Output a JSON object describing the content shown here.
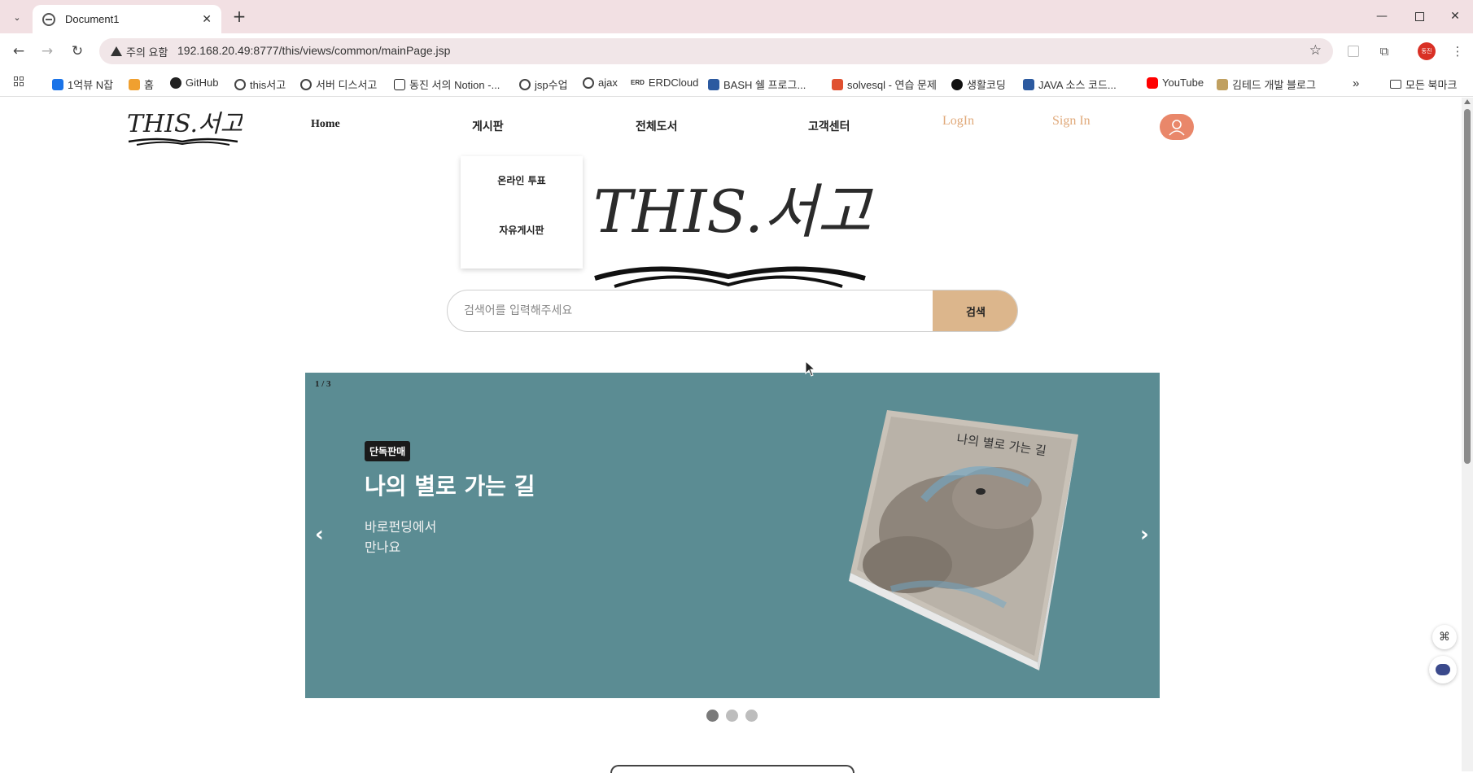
{
  "browser": {
    "tab_title": "Document1",
    "security_label": "주의 요함",
    "url": "192.168.20.49:8777/this/views/common/mainPage.jsp",
    "profile_label": "동진",
    "bookmarks": [
      {
        "label": "1억뷰 N잡",
        "color": "#1a73e8"
      },
      {
        "label": "홈",
        "color": "#f0a030"
      },
      {
        "label": "GitHub",
        "color": "#222222"
      },
      {
        "label": "this서고",
        "color": "#444444"
      },
      {
        "label": "서버 디스서고",
        "color": "#444444"
      },
      {
        "label": "동진 서의 Notion -...",
        "color": "#222222"
      },
      {
        "label": "jsp수업",
        "color": "#444444"
      },
      {
        "label": "ajax",
        "color": "#444444"
      },
      {
        "label": "ERDCloud",
        "color": "#333333"
      },
      {
        "label": "BASH 쉘 프로그...",
        "color": "#2c5aa0"
      },
      {
        "label": "solvesql - 연습 문제",
        "color": "#e05030"
      },
      {
        "label": "생활코딩",
        "color": "#111111"
      },
      {
        "label": "JAVA 소스 코드...",
        "color": "#2c5aa0"
      },
      {
        "label": "YouTube",
        "color": "#ff0000"
      },
      {
        "label": "김테드 개발 블로그",
        "color": "#c0a060"
      }
    ],
    "more_bookmarks_label": "»",
    "all_bookmarks_label": "모든 북마크"
  },
  "site": {
    "logo_text": "THIS.서고",
    "nav": {
      "home": "Home",
      "board": "게시판",
      "all_books": "전체도서",
      "customer_center": "고객센터",
      "login": "LogIn",
      "signin": "Sign In"
    },
    "board_menu": [
      "온라인 투표",
      "자유게시판"
    ],
    "hero_logo_text": "THIS.서고",
    "search": {
      "placeholder": "검색어를 입력해주세요",
      "button": "검색"
    },
    "banner": {
      "counter": "1 / 3",
      "badge": "단독판매",
      "title": "나의 별로 가는 길",
      "subtitle_line1": "바로펀딩에서",
      "subtitle_line2": "만나요",
      "cover_title": "나의 별로 가는 길",
      "background": "#5b8c93",
      "slide_count": 3,
      "active_slide": 1
    },
    "colors": {
      "accent": "#dcb68c",
      "auth_text": "#e0a97a",
      "avatar": "#e9876a"
    }
  }
}
